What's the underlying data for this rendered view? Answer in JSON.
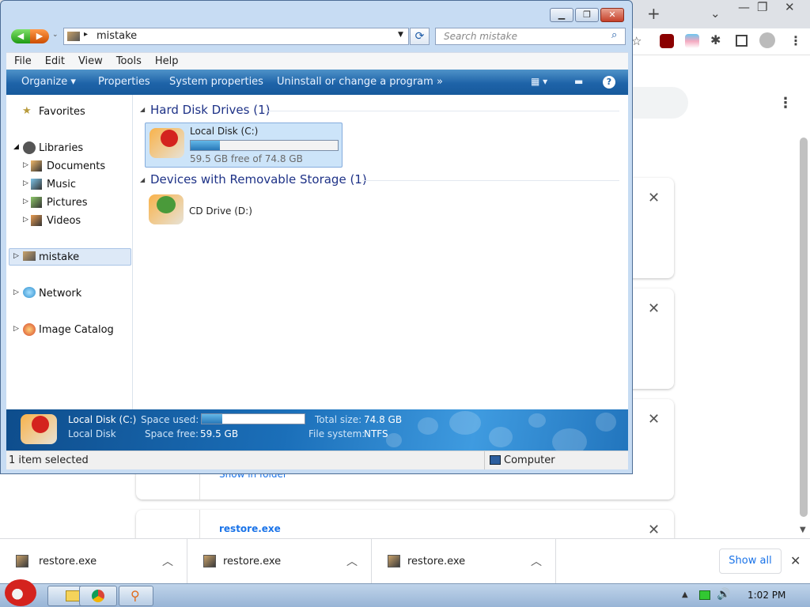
{
  "browser": {
    "downloads": [
      {
        "filename": "restore.exe"
      },
      {
        "filename": "restore.exe"
      },
      {
        "filename": "restore.exe"
      }
    ],
    "show_all_label": "Show all",
    "list_items": [
      {
        "link": "Show in folder"
      },
      {
        "filename": "restore.exe"
      }
    ]
  },
  "explorer": {
    "address": {
      "crumb": "mistake"
    },
    "search": {
      "placeholder": "Search mistake"
    },
    "menu": [
      "File",
      "Edit",
      "View",
      "Tools",
      "Help"
    ],
    "commands": {
      "organize": "Organize",
      "properties": "Properties",
      "system_properties": "System properties",
      "uninstall": "Uninstall or change a program",
      "more": "»"
    },
    "nav": {
      "favorites": "Favorites",
      "libraries": "Libraries",
      "documents": "Documents",
      "music": "Music",
      "pictures": "Pictures",
      "videos": "Videos",
      "mistake": "mistake",
      "network": "Network",
      "image_catalog": "Image Catalog"
    },
    "groups": {
      "hdd": "Hard Disk Drives (1)",
      "removable": "Devices with Removable Storage (1)"
    },
    "drives": {
      "c_name": "Local Disk (C:)",
      "c_free": "59.5 GB free of 74.8 GB",
      "c_used_fraction": 0.2,
      "d_name": "CD Drive (D:)"
    },
    "details": {
      "name": "Local Disk (C:)",
      "type": "Local Disk",
      "space_used_label": "Space used:",
      "space_free_label": "Space free:",
      "space_free": "59.5 GB",
      "total_size_label": "Total size:",
      "total_size": "74.8 GB",
      "fs_label": "File system:",
      "fs": "NTFS"
    },
    "status": {
      "left": "1 item selected",
      "right": "Computer"
    }
  },
  "taskbar": {
    "time": "1:02 PM"
  }
}
